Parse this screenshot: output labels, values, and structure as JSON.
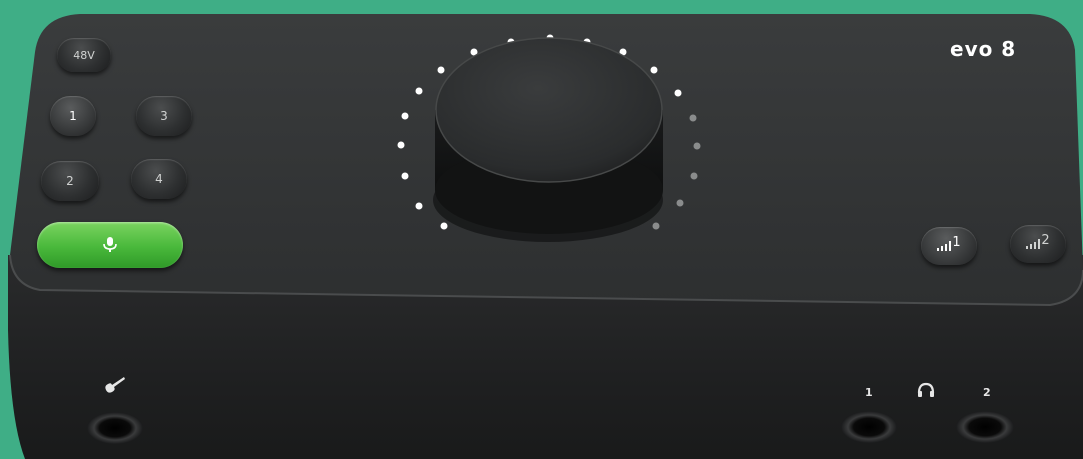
{
  "device": {
    "brand": "evo 8"
  },
  "top_panel": {
    "phantom_button": "48V",
    "input_buttons": [
      "1",
      "3",
      "2",
      "4"
    ],
    "mic_button_icon": "microphone-icon",
    "output_buttons": [
      "1",
      "2"
    ],
    "output_icon": "signal-bars-icon"
  },
  "front_panel": {
    "instrument_icon": "guitar-icon",
    "headphone_labels": [
      "1",
      "2"
    ],
    "headphone_icon": "headphones-icon"
  },
  "colors": {
    "background": "#3fae86",
    "body": "#2b2d2e",
    "mic_button": "#4cbb3c",
    "led_on": "#ffffff",
    "led_off": "#8a8c8c"
  }
}
